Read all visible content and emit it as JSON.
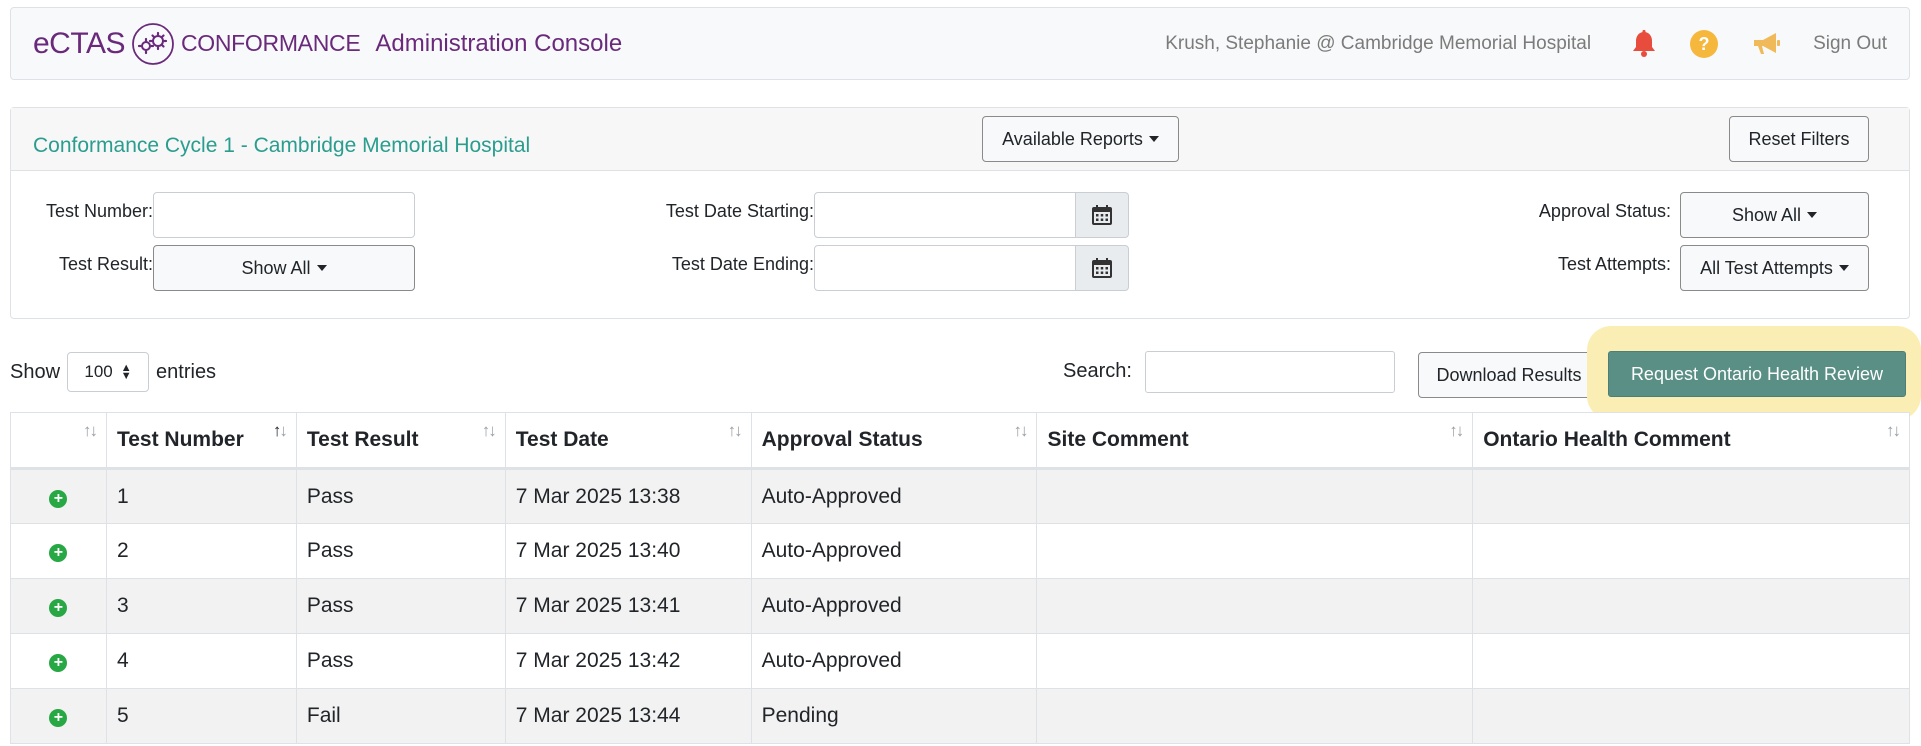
{
  "nav": {
    "brand_ectas": "eCTAS",
    "brand_conformance": "CONFORMANCE",
    "console_title": "Administration Console",
    "user": "Krush, Stephanie @ Cambridge Memorial Hospital",
    "signout": "Sign Out",
    "icons": [
      "bell-icon",
      "help-icon",
      "megaphone-icon"
    ],
    "colors": {
      "brand": "#6a2a7c",
      "bell": "#e74c3c",
      "help": "#f5b83d",
      "megaphone": "#f0b95a"
    }
  },
  "filter": {
    "cycle_title": "Conformance Cycle 1 - Cambridge Memorial Hospital",
    "available_reports": "Available Reports",
    "reset_filters": "Reset Filters",
    "test_number_label": "Test Number:",
    "test_result_label": "Test Result:",
    "test_result_value": "Show All",
    "date_start_label": "Test Date Starting:",
    "date_end_label": "Test Date Ending:",
    "approval_label": "Approval Status:",
    "approval_value": "Show All",
    "attempts_label": "Test Attempts:",
    "attempts_value": "All Test Attempts",
    "accent": "#2a9d8f"
  },
  "controls": {
    "show_label": "Show",
    "page_size": "100",
    "entries_label": "entries",
    "search_label": "Search:",
    "download": "Download Results",
    "request_review": "Request Ontario Health Review",
    "review_color": "#5a8f85",
    "highlight_color": "#fbeeb4"
  },
  "table": {
    "headers": [
      "",
      "Test Number",
      "Test Result",
      "Test Date",
      "Approval Status",
      "Site Comment",
      "Ontario Health Comment"
    ],
    "rows": [
      {
        "num": "1",
        "result": "Pass",
        "date": "7 Mar 2025 13:38",
        "status": "Auto-Approved",
        "site": "",
        "oh": ""
      },
      {
        "num": "2",
        "result": "Pass",
        "date": "7 Mar 2025 13:40",
        "status": "Auto-Approved",
        "site": "",
        "oh": ""
      },
      {
        "num": "3",
        "result": "Pass",
        "date": "7 Mar 2025 13:41",
        "status": "Auto-Approved",
        "site": "",
        "oh": ""
      },
      {
        "num": "4",
        "result": "Pass",
        "date": "7 Mar 2025 13:42",
        "status": "Auto-Approved",
        "site": "",
        "oh": ""
      },
      {
        "num": "5",
        "result": "Fail",
        "date": "7 Mar 2025 13:44",
        "status": "Pending",
        "site": "",
        "oh": ""
      }
    ]
  }
}
